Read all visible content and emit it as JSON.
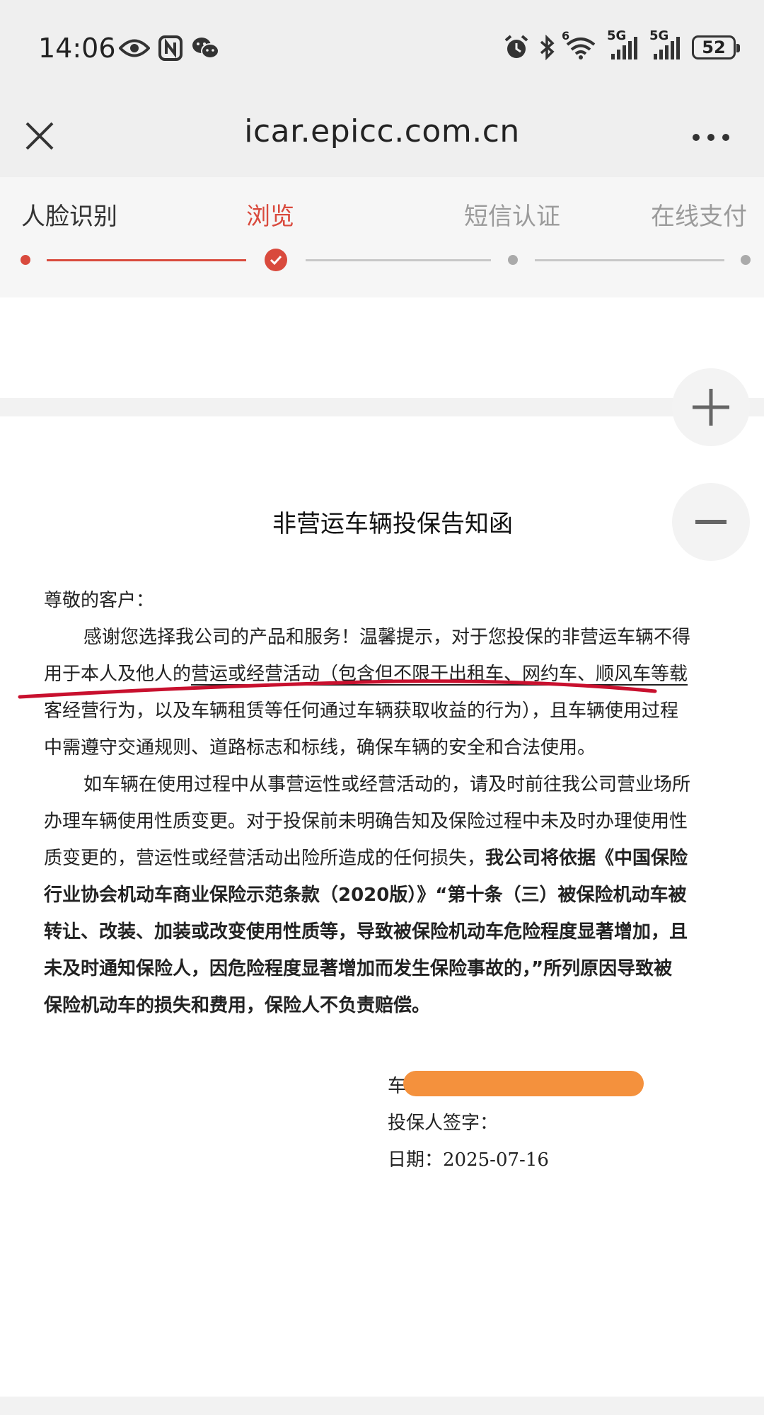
{
  "status_bar": {
    "time": "14:06",
    "icons_left": [
      "eye-icon",
      "nfc-icon",
      "wechat-icon"
    ],
    "icons_right": [
      "alarm-icon",
      "bluetooth-icon",
      "wifi-6-icon",
      "signal-5g-icon",
      "signal-5g-icon"
    ],
    "wifi_badge": "6",
    "net_label_1": "5G",
    "net_label_2": "5G",
    "battery": "52"
  },
  "nav": {
    "url": "icar.epicc.com.cn",
    "close_icon": "close-icon",
    "more_icon": "more-icon"
  },
  "steps": [
    {
      "label": "人脸识别",
      "state": "done"
    },
    {
      "label": "浏览",
      "state": "active"
    },
    {
      "label": "短信认证",
      "state": "todo"
    },
    {
      "label": "在线支付",
      "state": "todo"
    }
  ],
  "colors": {
    "accent": "#d94a3d",
    "todo": "#9b9b9b",
    "redaction": "#f4913d",
    "bar_bg": "#efefef"
  },
  "document": {
    "title": "非营运车辆投保告知函",
    "greeting": "尊敬的客户：",
    "p1_line1": "感谢您选择我公司的产品和服务！温馨提示，对于您投保的非营运车辆不得",
    "p1_line2a": "用于本人及他人的",
    "p1_line2b": "营运或经营活动（包含但不限于出租车、网约车、顺风车等载",
    "p1_line3": "客经营行为，以及车辆租赁等任何通过车辆获取收益的行为），且车辆使用过程",
    "p1_line4": "中需遵守交通规则、道路标志和标线，确保车辆的安全和合法使用。",
    "p2_line1": "如车辆在使用过程中从事营运性或经营活动的，请及时前往我公司营业场所",
    "p2_line2": "办理车辆使用性质变更。对于投保前未明确告知及保险过程中未及时办理使用性",
    "p2_line3a": "质变更的，营运性或经营活动出险所造成的任何损失，",
    "p2_line3b": "我公司将依据《中国保险",
    "p2_line4": "行业协会机动车商业保险示范条款（2020版）》“第十条（三）被保险机动车被",
    "p2_line5": "转让、改装、加装或改变使用性质等，导致被保险机动车危险程度显著增加，且",
    "p2_line6": "未及时通知保险人，因危险程度显著增加而发生保险事故的，”所列原因导致被",
    "p2_line7": "保险机动车的损失和费用，保险人不负责赔偿。",
    "sign_vehicle_prefix": "车",
    "sign_label": "投保人签字：",
    "date_label": "日期：2025-07-16"
  },
  "zoom": {
    "in_icon": "plus-icon",
    "out_icon": "minus-icon"
  }
}
